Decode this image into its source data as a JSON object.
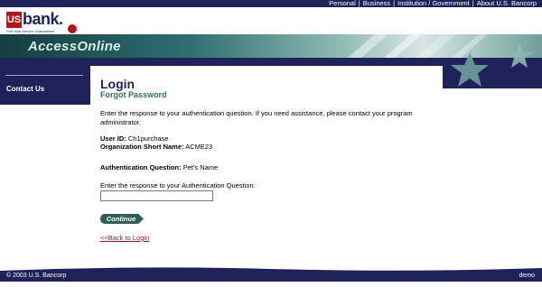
{
  "topnav": {
    "items": [
      "Personal",
      "Business",
      "Institution / Government",
      "About U.S. Bancorp"
    ],
    "separator": "|"
  },
  "logo": {
    "mark": "US",
    "bank": "bank.",
    "tagline": "Five Star Service Guaranteed"
  },
  "banner": {
    "title": "AccessOnline"
  },
  "sidebar": {
    "contact": "Contact Us"
  },
  "main": {
    "title": "Login",
    "subtitle": "Forgot Password",
    "intro": "Enter the response to your authentication question. If you need assistance, please contact your program administrator.",
    "user_id_label": "User ID:",
    "user_id_value": "Ch1purchase",
    "org_label": "Organization Short Name:",
    "org_value": "ACME23",
    "question_label": "Authentication Question:",
    "question_value": "Pet's Name",
    "prompt": "Enter the response to your Authentication Question:",
    "answer_value": "",
    "continue": "Continue",
    "back": "<<Back to Login"
  },
  "footer": {
    "copyright": "© 2003 U.S. Bancorp",
    "mode": "demo"
  },
  "colors": {
    "navy": "#1f2159",
    "teal": "#2f6e70",
    "red": "#b5121b",
    "green": "#2f6e53"
  },
  "icons": [
    "seal-icon"
  ]
}
